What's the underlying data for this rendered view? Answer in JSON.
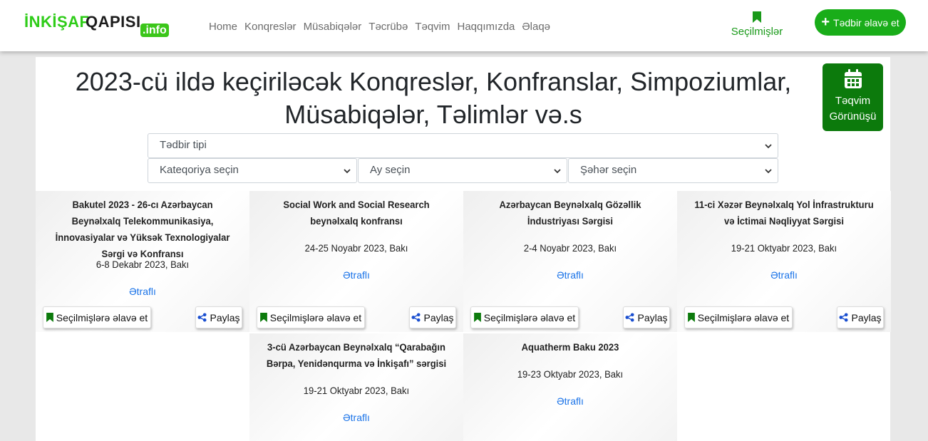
{
  "logo": {
    "part1": "İNKİŞAF",
    "part2": "QAPISI",
    "part3": ".info"
  },
  "nav": {
    "links": [
      "Home",
      "Konqreslər",
      "Müsabiqələr",
      "Təcrübə",
      "Təqvim",
      "Haqqımızda",
      "Əlaqə"
    ],
    "favorites_label": "Seçilmişlər",
    "add_event_label": "Tədbir əlavə et"
  },
  "main": {
    "title": "2023-cü ildə keçiriləcək Konqreslər, Konfranslar, Simpoziumlar, Müsabiqələr, Təlimlər və.s",
    "calendar_view_label": "Təqvim Görünüşü"
  },
  "filters": {
    "event_type": "Tədbir tipi",
    "category": "Kateqoriya seçin",
    "month": "Ay seçin",
    "city": "Şəhər seçin"
  },
  "card_actions": {
    "favorite_label": "Seçilmişlərə əlavə et",
    "share_label": "Paylaş",
    "more_label": "Ətraflı"
  },
  "events": [
    {
      "title": "Bakutel 2023 - 26-cı Azərbaycan Beynəlxalq Telekommunikasiya, İnnovasiyalar və Yüksək Texnologiyalar Sərgi və Konfransı",
      "date": "6-8 Dekabr 2023, Bakı"
    },
    {
      "title": "Social Work and Social Research beynəlxalq konfransı",
      "date": "24-25 Noyabr 2023, Bakı"
    },
    {
      "title": "Azərbaycan Beynəlxalq Gözəllik İndustriyası Sərgisi",
      "date": "2-4 Noyabr 2023, Bakı"
    },
    {
      "title": "11-ci Xəzər Beynəlxalq Yol İnfrastrukturu və İctimai Nəqliyyat Sərgisi",
      "date": "19-21 Oktyabr 2023, Bakı"
    },
    {
      "title": "3-cü Azərbaycan Beynəlxalq “Qarabağın Bərpa, Yenidənqurma və İnkişafı” sərgisi",
      "date": "19-21 Oktyabr 2023, Bakı"
    },
    {
      "title": "Aquatherm Baku 2023",
      "date": "19-23 Oktyabr 2023, Bakı"
    }
  ],
  "colors": {
    "brand_green": "#19ad19",
    "dark_green": "#0c7a0c",
    "link_blue": "#1a73e8"
  },
  "icons": {
    "bookmark": "bookmark-icon",
    "share": "share-icon",
    "calendar": "calendar-icon",
    "plus": "plus-icon"
  }
}
